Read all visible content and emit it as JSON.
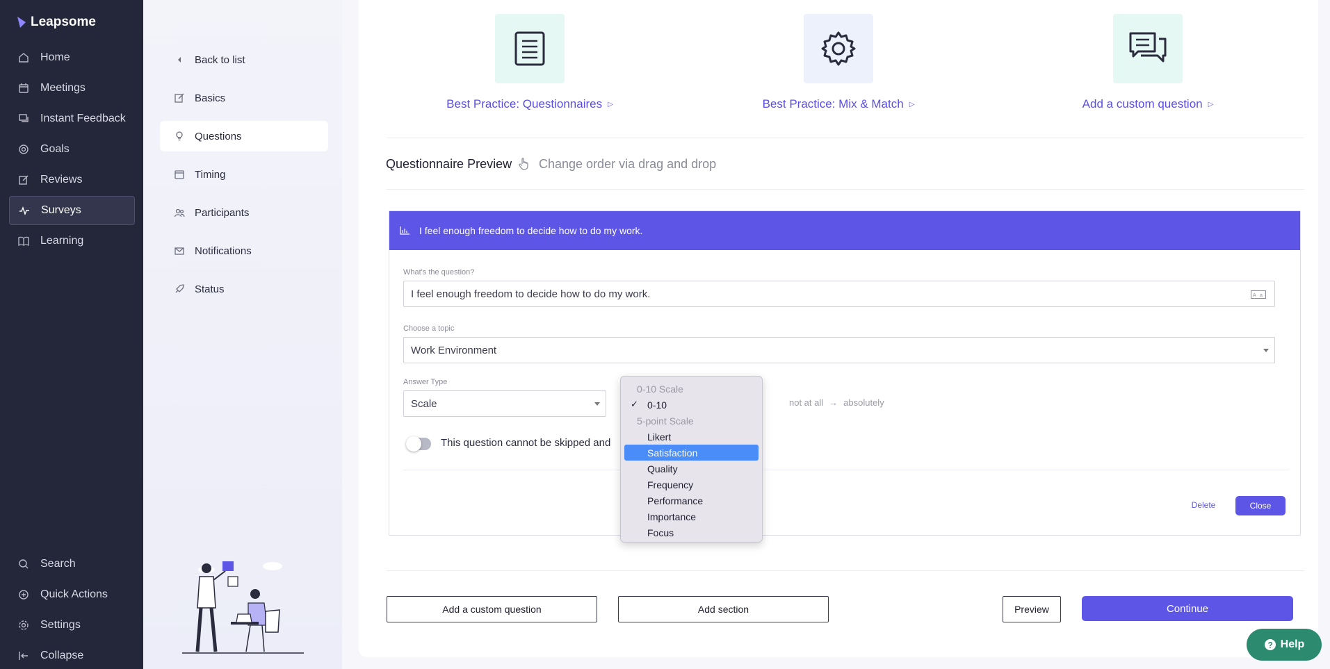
{
  "app": {
    "name": "Leapsome"
  },
  "sidebar": {
    "items": [
      {
        "label": "Home",
        "icon": "home-icon"
      },
      {
        "label": "Meetings",
        "icon": "calendar-icon"
      },
      {
        "label": "Instant Feedback",
        "icon": "chat-icon"
      },
      {
        "label": "Goals",
        "icon": "target-icon"
      },
      {
        "label": "Reviews",
        "icon": "edit-icon"
      },
      {
        "label": "Surveys",
        "icon": "pulse-icon",
        "active": true
      },
      {
        "label": "Learning",
        "icon": "book-icon"
      }
    ],
    "bottom": [
      {
        "label": "Search",
        "icon": "search-icon"
      },
      {
        "label": "Quick Actions",
        "icon": "plus-circle-icon"
      },
      {
        "label": "Settings",
        "icon": "gear-icon"
      },
      {
        "label": "Collapse",
        "icon": "collapse-icon"
      }
    ]
  },
  "subnav": {
    "back": "Back to list",
    "items": [
      {
        "label": "Basics",
        "icon": "edit-icon"
      },
      {
        "label": "Questions",
        "icon": "lightbulb-icon",
        "active": true
      },
      {
        "label": "Timing",
        "icon": "calendar-icon"
      },
      {
        "label": "Participants",
        "icon": "people-icon"
      },
      {
        "label": "Notifications",
        "icon": "mail-icon"
      },
      {
        "label": "Status",
        "icon": "rocket-icon"
      }
    ]
  },
  "best_practices": [
    {
      "label": "Best Practice: Questionnaires",
      "icon": "document-icon",
      "tile_color": "#e6f8f4"
    },
    {
      "label": "Best Practice: Mix & Match",
      "icon": "gear-icon",
      "tile_color": "#ecf1fb"
    },
    {
      "label": "Add a custom question",
      "icon": "chat-icon",
      "tile_color": "#e6f8f4"
    }
  ],
  "preview": {
    "title": "Questionnaire Preview",
    "hint": "Change order via drag and drop"
  },
  "question": {
    "header": "I feel enough freedom to decide how to do my work.",
    "question_label": "What's the question?",
    "question_value": "I feel enough freedom to decide how to do my work.",
    "topic_label": "Choose a topic",
    "topic_value": "Work Environment",
    "answer_type_label": "Answer Type",
    "answer_type_value": "Scale",
    "scale_low": "not at all",
    "scale_high": "absolutely",
    "required_text": "This question cannot be skipped and",
    "delete_label": "Delete",
    "close_label": "Close"
  },
  "dropdown": {
    "options": [
      {
        "label": "0-10 Scale",
        "group": true
      },
      {
        "label": "0-10",
        "checked": true
      },
      {
        "label": "5-point Scale",
        "group": true
      },
      {
        "label": "Likert"
      },
      {
        "label": "Satisfaction",
        "selected": true
      },
      {
        "label": "Quality"
      },
      {
        "label": "Frequency"
      },
      {
        "label": "Performance"
      },
      {
        "label": "Importance"
      },
      {
        "label": "Focus"
      }
    ]
  },
  "footer": {
    "add_custom": "Add a custom question",
    "add_section": "Add section",
    "preview": "Preview",
    "continue": "Continue"
  },
  "help": {
    "label": "Help"
  },
  "colors": {
    "accent": "#5c55e6",
    "sidebar": "#242639",
    "help": "#2c8a6e",
    "highlight": "#4b8df8"
  }
}
